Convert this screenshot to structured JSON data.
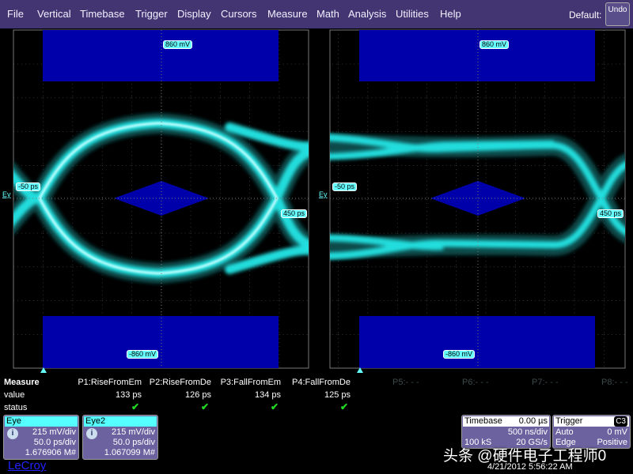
{
  "menu": [
    "File",
    "Vertical",
    "Timebase",
    "Trigger",
    "Display",
    "Cursors",
    "Measure",
    "Math",
    "Analysis",
    "Utilities",
    "Help"
  ],
  "default_label": "Default:",
  "undo_label": "Undo",
  "grids": [
    {
      "top_level": "860 mV",
      "bottom_level": "-860 mV",
      "left_time": "-50 ps",
      "right_time": "450 ps",
      "marker": "Ey"
    },
    {
      "top_level": "860 mV",
      "bottom_level": "-860 mV",
      "left_time": "-50 ps",
      "right_time": "450 ps",
      "marker": "Ey"
    }
  ],
  "measure": {
    "header": "Measure",
    "row_value": "value",
    "row_status": "status",
    "params": [
      {
        "name": "P1:RiseFromEm",
        "value": "133 ps",
        "status": "ok"
      },
      {
        "name": "P2:RiseFromDe",
        "value": "126 ps",
        "status": "ok"
      },
      {
        "name": "P3:FallFromEm",
        "value": "134 ps",
        "status": "ok"
      },
      {
        "name": "P4:FallFromDe",
        "value": "125 ps",
        "status": "ok"
      },
      {
        "name": "P5:- - -"
      },
      {
        "name": "P6:- - -"
      },
      {
        "name": "P7:- - -"
      },
      {
        "name": "P8:- - -"
      }
    ],
    "check": "✔"
  },
  "channels": [
    {
      "name": "Eye",
      "vdiv": "215 mV/div",
      "tdiv": "50.0 ps/div",
      "count": "1.676906 M#"
    },
    {
      "name": "Eye2",
      "vdiv": "215 mV/div",
      "tdiv": "50.0 ps/div",
      "count": "1.067099 M#"
    }
  ],
  "timebase": {
    "title": "Timebase",
    "delay": "0.00 µs",
    "tdiv": "500 ns/div",
    "samples": "100 kS",
    "rate": "20 GS/s"
  },
  "trigger": {
    "title": "Trigger",
    "source": "C3",
    "mode": "Auto",
    "level": "0 mV",
    "type": "Edge",
    "slope": "Positive"
  },
  "logo": "LeCroy",
  "watermark": "头条 @硬件电子工程师0",
  "datetime": "4/21/2012 5:56:22 AM",
  "colors": {
    "menubar": "#433572",
    "mask": "#0000aa",
    "trace": "#33eeee",
    "panel": "#6c62a0"
  }
}
